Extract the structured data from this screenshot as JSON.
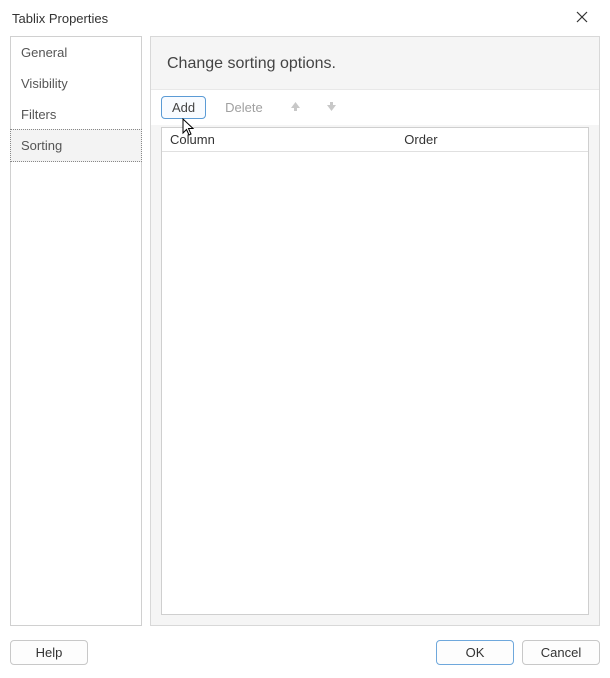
{
  "window": {
    "title": "Tablix Properties"
  },
  "sidebar": {
    "items": [
      {
        "label": "General",
        "selected": false
      },
      {
        "label": "Visibility",
        "selected": false
      },
      {
        "label": "Filters",
        "selected": false
      },
      {
        "label": "Sorting",
        "selected": true
      }
    ]
  },
  "main": {
    "heading": "Change sorting options.",
    "toolbar": {
      "add_label": "Add",
      "delete_label": "Delete"
    },
    "columns": {
      "col1": "Column",
      "col2": "Order"
    }
  },
  "footer": {
    "help_label": "Help",
    "ok_label": "OK",
    "cancel_label": "Cancel"
  }
}
